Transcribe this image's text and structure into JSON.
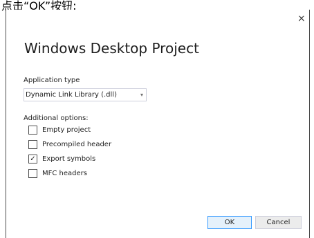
{
  "caption": "点击“OK”按钮:",
  "dialog": {
    "close_glyph": "×",
    "title": "Windows Desktop Project",
    "application_type_label": "Application type",
    "application_type_value": "Dynamic Link Library (.dll)",
    "dropdown_arrow": "▾",
    "additional_options_label": "Additional options:",
    "options": [
      {
        "label": "Empty project",
        "checked": false
      },
      {
        "label": "Precompiled header",
        "checked": false
      },
      {
        "label": "Export symbols",
        "checked": true
      },
      {
        "label": "MFC headers",
        "checked": false
      }
    ],
    "ok_label": "OK",
    "cancel_label": "Cancel"
  }
}
